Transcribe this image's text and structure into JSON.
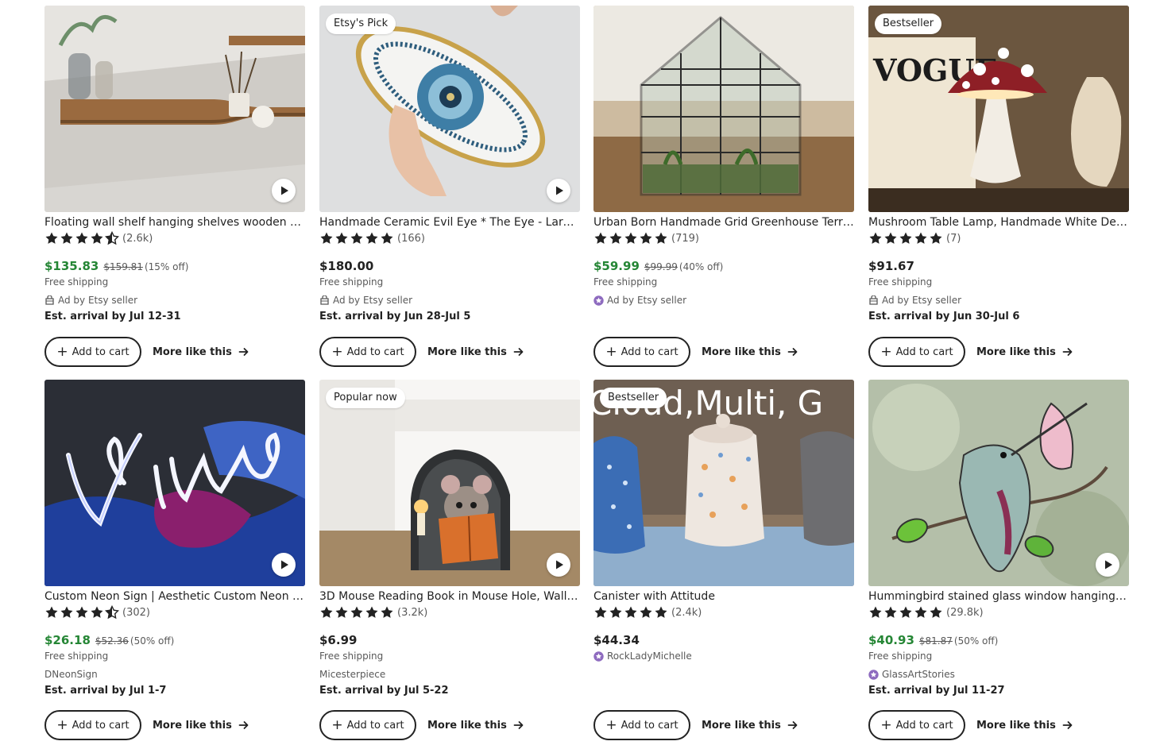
{
  "colors": {
    "sale_price": "#258635",
    "text": "#222222",
    "muted": "#595959",
    "star_seller": "#8e6bbf"
  },
  "labels": {
    "add_to_cart": "Add to cart",
    "more_like_this": "More like this"
  },
  "products": [
    {
      "title": "Floating wall shelf hanging shelves wooden bo...",
      "rating": 4.5,
      "reviews": "(2.6k)",
      "price": "$135.83",
      "original_price": "$159.81",
      "discount": "(15% off)",
      "shipping": "Free shipping",
      "seller": "Ad by Etsy seller",
      "seller_icon": "ad-icon",
      "arrival": "Est. arrival by Jul 12-31",
      "badge": "",
      "has_video": true
    },
    {
      "title": "Handmade Ceramic Evil Eye * The Eye - Large / ...",
      "rating": 5,
      "reviews": "(166)",
      "price": "$180.00",
      "original_price": "",
      "discount": "",
      "shipping": "Free shipping",
      "seller": "Ad by Etsy seller",
      "seller_icon": "ad-icon",
      "arrival": "Est. arrival by Jun 28-Jul 5",
      "badge": "Etsy's Pick",
      "has_video": true
    },
    {
      "title": "Urban Born Handmade Grid Greenhouse Terrar...",
      "rating": 5,
      "reviews": "(719)",
      "price": "$59.99",
      "original_price": "$99.99",
      "discount": "(40% off)",
      "shipping": "Free shipping",
      "seller": "Ad by Etsy seller",
      "seller_icon": "star-seller-icon",
      "arrival": "",
      "badge": "",
      "has_video": false
    },
    {
      "title": "Mushroom Table Lamp, Handmade White Desk ...",
      "rating": 5,
      "reviews": "(7)",
      "price": "$91.67",
      "original_price": "",
      "discount": "",
      "shipping": "Free shipping",
      "seller": "Ad by Etsy seller",
      "seller_icon": "ad-icon",
      "arrival": "Est. arrival by Jun 30-Jul 6",
      "badge": "Bestseller",
      "has_video": false
    },
    {
      "title": "Custom Neon Sign | Aesthetic Custom Neon Si...",
      "rating": 4.5,
      "reviews": "(302)",
      "price": "$26.18",
      "original_price": "$52.36",
      "discount": "(50% off)",
      "shipping": "Free shipping",
      "seller": "DNeonSign",
      "seller_icon": "",
      "arrival": "Est. arrival by Jul 1-7",
      "badge": "",
      "has_video": true
    },
    {
      "title": "3D Mouse Reading Book in Mouse Hole, Wall D...",
      "rating": 5,
      "reviews": "(3.2k)",
      "price": "$6.99",
      "original_price": "",
      "discount": "",
      "shipping": "Free shipping",
      "seller": "Micesterpiece",
      "seller_icon": "",
      "arrival": "Est. arrival by Jul 5-22",
      "badge": "Popular now",
      "has_video": true
    },
    {
      "title": "Canister with Attitude",
      "rating": 5,
      "reviews": "(2.4k)",
      "price": "$44.34",
      "original_price": "",
      "discount": "",
      "shipping": "",
      "seller": "RockLadyMichelle",
      "seller_icon": "star-seller-icon",
      "arrival": "",
      "badge": "Bestseller",
      "has_video": false,
      "image_overlay_text": "Cloud,Multi, G"
    },
    {
      "title": "Hummingbird stained glass window hangings ...",
      "rating": 5,
      "reviews": "(29.8k)",
      "price": "$40.93",
      "original_price": "$81.87",
      "discount": "(50% off)",
      "shipping": "Free shipping",
      "seller": "GlassArtStories",
      "seller_icon": "star-seller-icon",
      "arrival": "Est. arrival by Jul 11-27",
      "badge": "",
      "has_video": true
    }
  ]
}
